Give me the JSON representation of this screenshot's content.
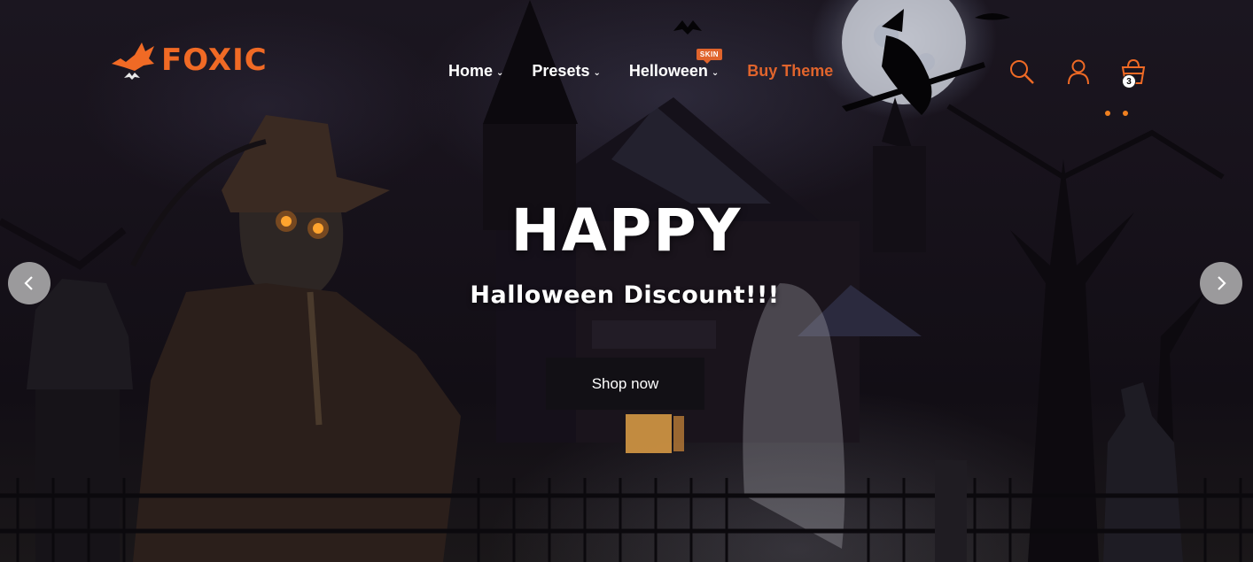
{
  "brand": {
    "name": "FOXIC",
    "color": "#f06a25"
  },
  "nav": {
    "items": [
      {
        "label": "Home",
        "has_dropdown": true
      },
      {
        "label": "Presets",
        "has_dropdown": true
      },
      {
        "label": "Helloween",
        "has_dropdown": true,
        "badge": "SKIN"
      },
      {
        "label": "Buy Theme",
        "has_dropdown": false
      }
    ],
    "accent": "#e0642c"
  },
  "header_icons": {
    "search": "search-icon",
    "account": "user-icon",
    "cart": "cart-icon",
    "cart_count": "3"
  },
  "hero": {
    "title": "HAPPY",
    "subtitle": "Halloween Discount!!!",
    "button": "Shop now"
  },
  "slider": {
    "prev": "chevron-left-icon",
    "next": "chevron-right-icon"
  }
}
